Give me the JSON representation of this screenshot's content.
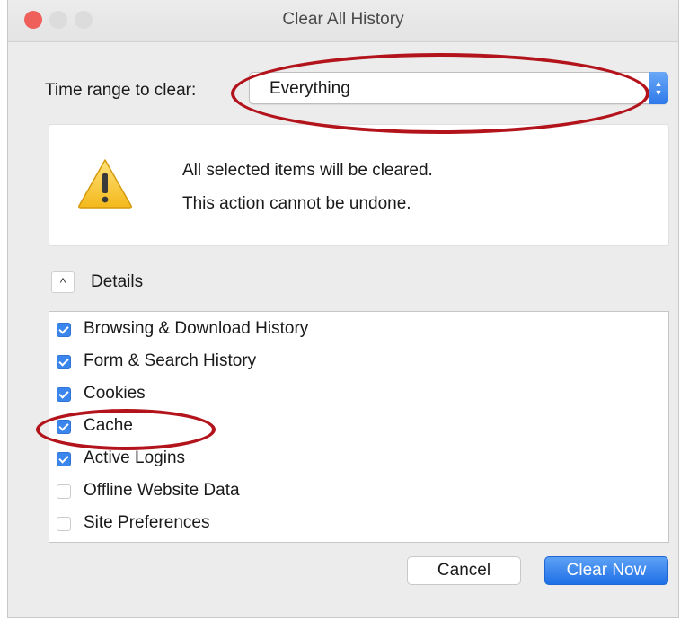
{
  "window": {
    "title": "Clear All History"
  },
  "time_range": {
    "label": "Time range to clear:",
    "selected": "Everything"
  },
  "warning": {
    "icon": "warning-icon",
    "line1": "All selected items will be cleared.",
    "line2": "This action cannot be undone."
  },
  "details": {
    "toggle_icon": "chevron-up-icon",
    "label": "Details",
    "items": [
      {
        "label": "Browsing & Download History",
        "checked": true
      },
      {
        "label": "Form & Search History",
        "checked": true
      },
      {
        "label": "Cookies",
        "checked": true
      },
      {
        "label": "Cache",
        "checked": true
      },
      {
        "label": "Active Logins",
        "checked": true
      },
      {
        "label": "Offline Website Data",
        "checked": false
      },
      {
        "label": "Site Preferences",
        "checked": false
      }
    ]
  },
  "buttons": {
    "cancel": "Cancel",
    "clear_now": "Clear Now"
  },
  "colors": {
    "accent": "#2f79ea",
    "annotation": "#b3141c",
    "close_button": "#f0605a"
  }
}
